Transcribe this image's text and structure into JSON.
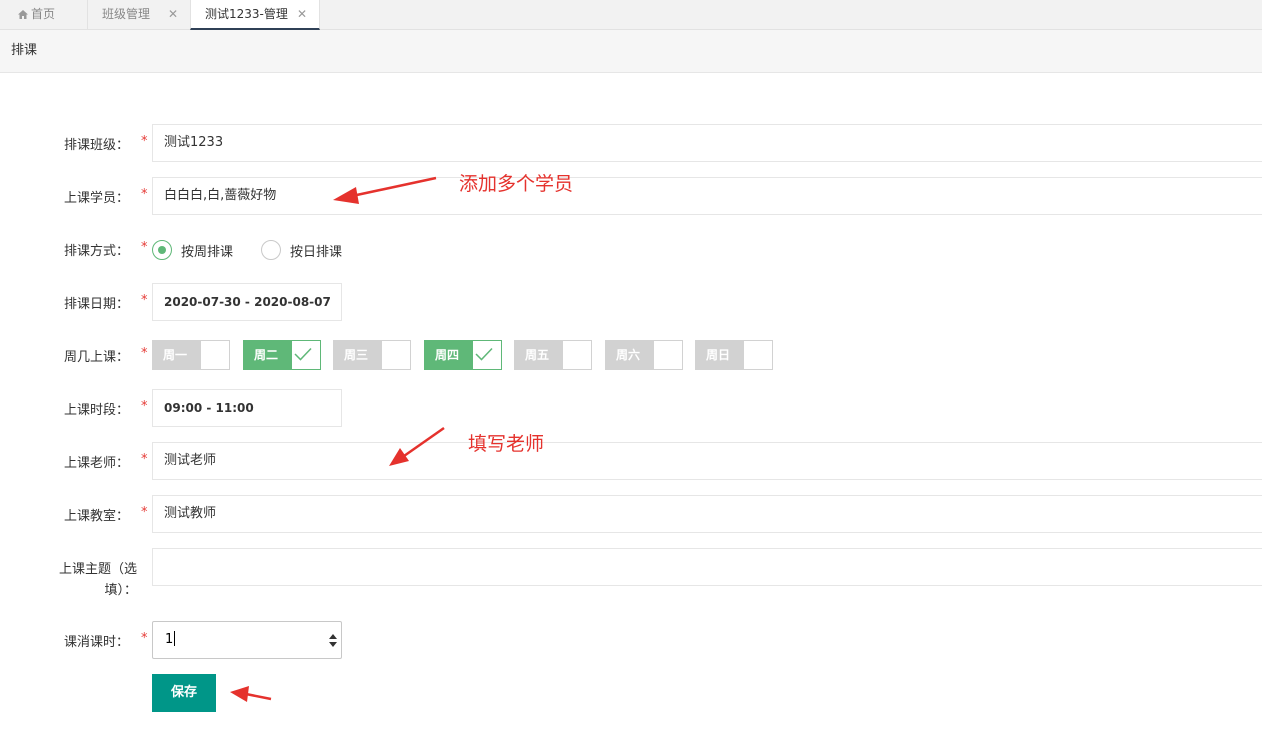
{
  "tabs": [
    {
      "label": "首页",
      "icon": "home-icon"
    },
    {
      "label": "班级管理",
      "close": "✕"
    },
    {
      "label": "测试1233-管理",
      "close": "✕"
    }
  ],
  "header": {
    "title": "排课"
  },
  "form": {
    "class_label": "排课班级：",
    "class_value": "测试1233",
    "students_label": "上课学员：",
    "students_value": "白白白,白,蔷薇好物",
    "mode_label": "排课方式：",
    "mode_options": [
      {
        "label": "按周排课",
        "selected": true
      },
      {
        "label": "按日排课",
        "selected": false
      }
    ],
    "date_label": "排课日期：",
    "date_value": "2020-07-30 - 2020-08-07",
    "weekday_label": "周几上课：",
    "weekdays": [
      {
        "label": "周一",
        "checked": false
      },
      {
        "label": "周二",
        "checked": true
      },
      {
        "label": "周三",
        "checked": false
      },
      {
        "label": "周四",
        "checked": true
      },
      {
        "label": "周五",
        "checked": false
      },
      {
        "label": "周六",
        "checked": false
      },
      {
        "label": "周日",
        "checked": false
      }
    ],
    "time_label": "上课时段：",
    "time_value": "09:00 - 11:00",
    "teacher_label": "上课老师：",
    "teacher_value": "测试老师",
    "room_label": "上课教室：",
    "room_value": "测试教师",
    "topic_label_line1": "上课主题（选",
    "topic_label_line2": "填）：",
    "topic_value": "",
    "hours_label": "课消课时：",
    "hours_value": "1",
    "required_mark": "*",
    "save_label": "保存"
  },
  "annotations": [
    {
      "text": "添加多个学员"
    },
    {
      "text": "填写老师"
    }
  ],
  "colors": {
    "accent_green": "#5fb878",
    "save_button": "#009688",
    "annotation_red": "#e5322d",
    "required_red": "#e53935"
  }
}
